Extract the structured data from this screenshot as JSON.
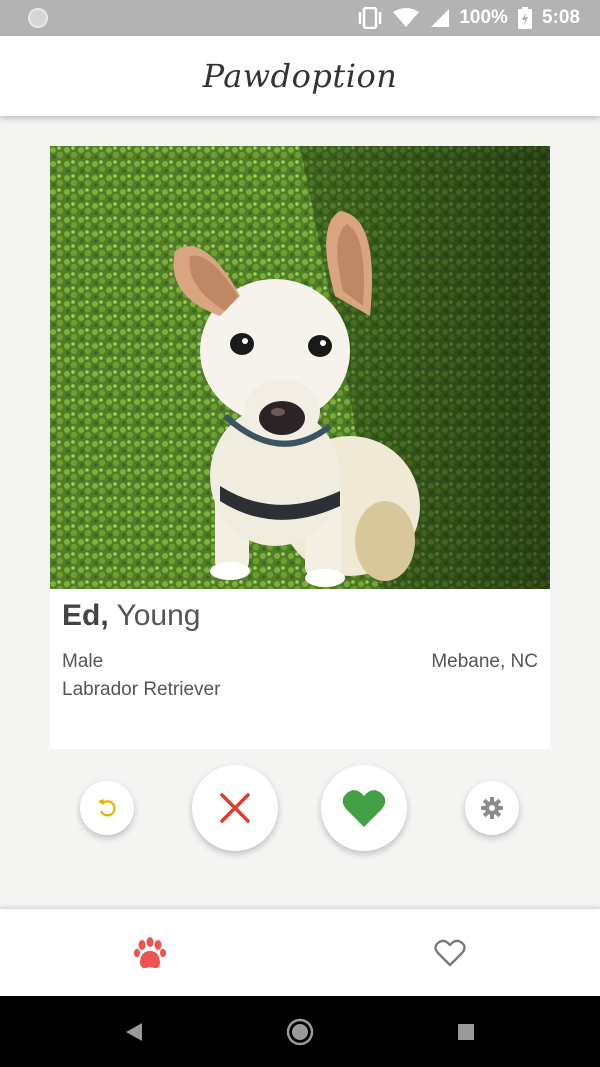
{
  "status_bar": {
    "battery": "100%",
    "time": "5:08"
  },
  "header": {
    "title": "Pawdoption"
  },
  "pet_card": {
    "name": "Ed,",
    "age": "Young",
    "gender": "Male",
    "location": "Mebane, NC",
    "breed": "Labrador Retriever",
    "photo_subject": "white puppy sitting on grass"
  },
  "actions": {
    "undo_icon": "undo-icon",
    "reject_icon": "close-icon",
    "like_icon": "heart-icon",
    "settings_icon": "gear-icon"
  },
  "bottom_nav": {
    "items": [
      {
        "icon": "paw-icon",
        "active": true
      },
      {
        "icon": "heart-outline-icon",
        "active": false
      }
    ]
  },
  "colors": {
    "reject": "#e53935",
    "like": "#43a047",
    "undo": "#e6b400",
    "active_nav": "#ef5350",
    "header_bg": "#ffffff",
    "status_bar_bg": "#b3b3b3"
  }
}
